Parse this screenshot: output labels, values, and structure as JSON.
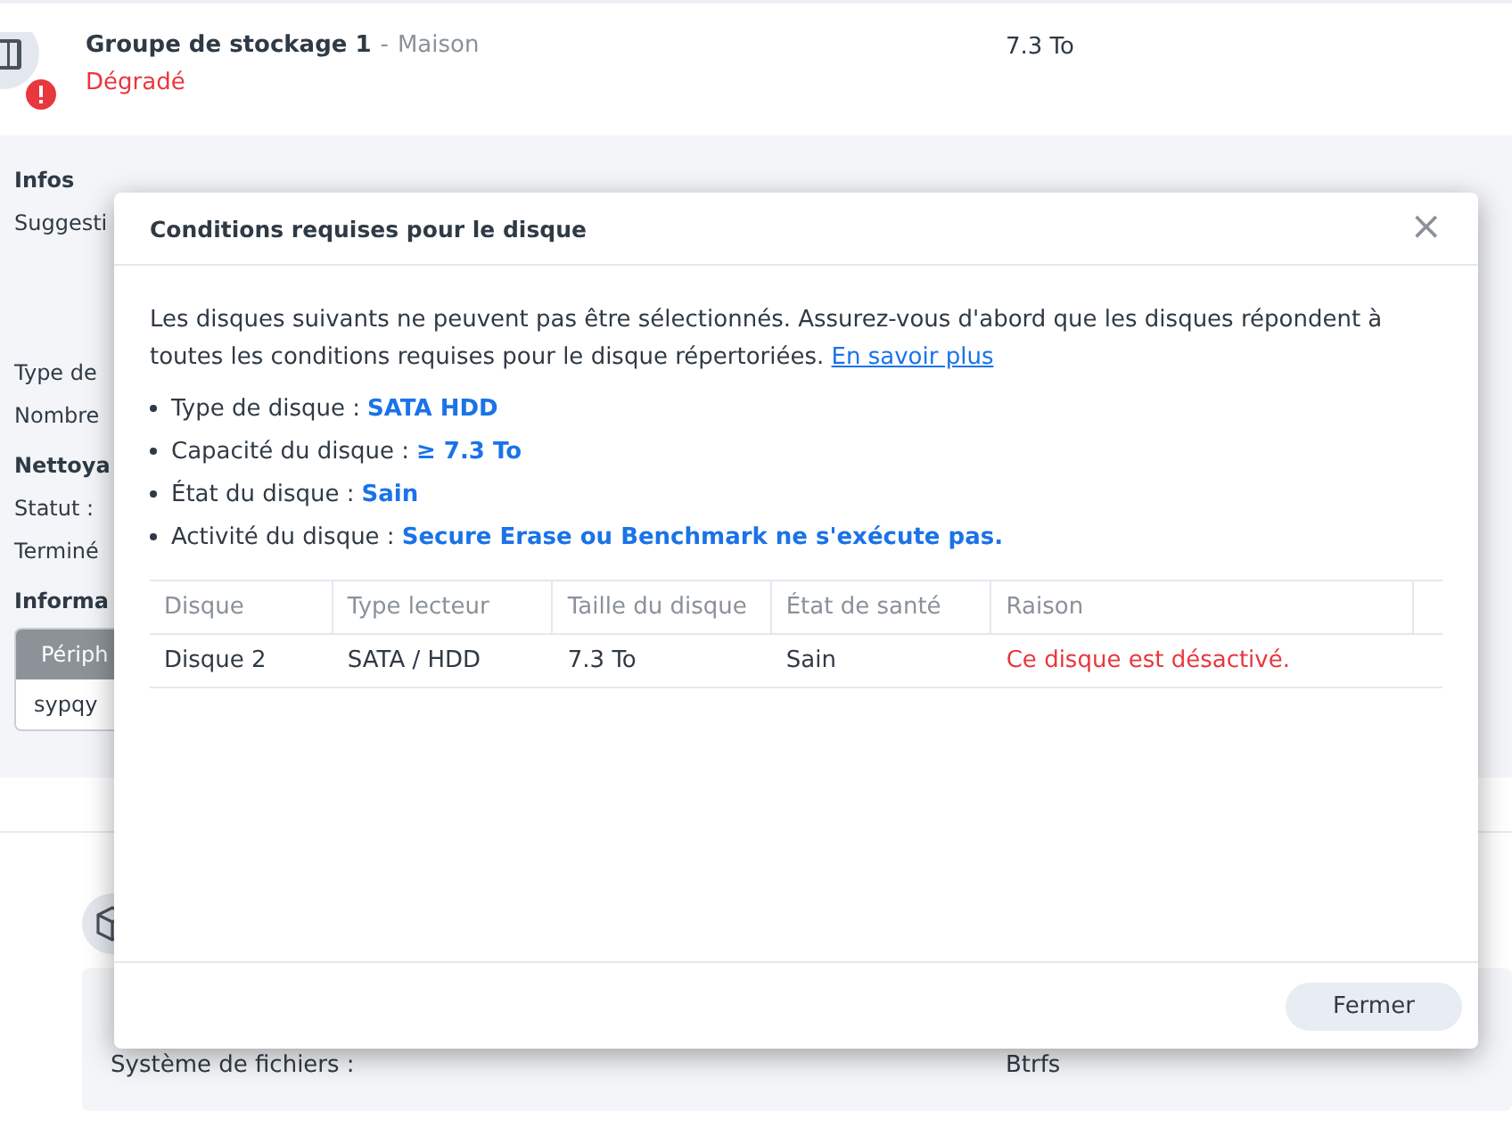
{
  "pool": {
    "title": "Groupe de stockage 1",
    "separator": "-",
    "subtitle": "Maison",
    "status": "Dégradé",
    "color": "#e8373d",
    "size": "7.3 To"
  },
  "background_sections": [
    {
      "heading": "Infos",
      "lines": [
        "Suggesti",
        "Type de",
        "Nombre"
      ]
    },
    {
      "heading": "Nettoya",
      "lines": [
        "Statut :",
        "Terminé"
      ]
    },
    {
      "heading": "Informa"
    }
  ],
  "background_table": {
    "header": "Périph",
    "cell": "sypqy"
  },
  "volume": {
    "label": "Système de fichiers :",
    "value": "Btrfs"
  },
  "dialog": {
    "title": "Conditions requises pour le disque",
    "close": "×",
    "intro": "Les disques suivants ne peuvent pas être sélectionnés. Assurez-vous d'abord que les disques répondent à toutes les conditions requises pour le disque répertoriées.",
    "link": "En savoir plus",
    "requirements": [
      {
        "label": "Type de disque :",
        "value": "SATA HDD"
      },
      {
        "label": "Capacité du disque :",
        "value": "≥ 7.3 To"
      },
      {
        "label": "État du disque :",
        "value": "Sain"
      },
      {
        "label": "Activité du disque :",
        "value": "Secure Erase ou Benchmark ne s'exécute pas."
      }
    ],
    "table": {
      "columns": [
        "Disque",
        "Type lecteur",
        "Taille du disque",
        "État de santé",
        "Raison"
      ],
      "rows": [
        {
          "cells": [
            "Disque 2",
            "SATA / HDD",
            "7.3 To",
            "Sain"
          ],
          "reason": "Ce disque est désactivé.",
          "color": "#e8373d"
        }
      ]
    },
    "buttons": [
      "Fermer"
    ]
  }
}
